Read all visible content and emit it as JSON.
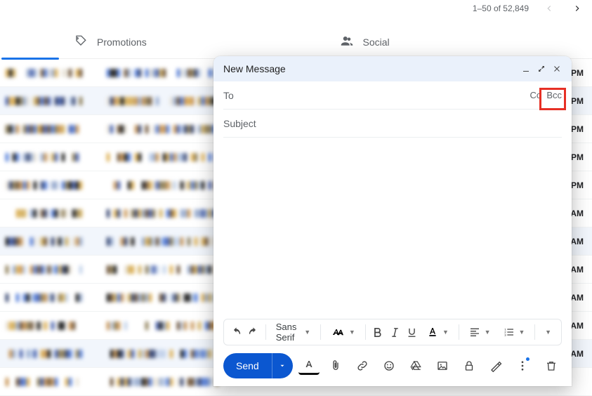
{
  "pager": {
    "range": "1–50 of 52,849"
  },
  "tabs": {
    "promotions": "Promotions",
    "social": "Social"
  },
  "rows": [
    {
      "time": "PM",
      "alt": false
    },
    {
      "time": "PM",
      "alt": true
    },
    {
      "time": "PM",
      "alt": false
    },
    {
      "time": "PM",
      "alt": false
    },
    {
      "time": "PM",
      "alt": false
    },
    {
      "time": "AM",
      "alt": false
    },
    {
      "time": "AM",
      "alt": true
    },
    {
      "time": "AM",
      "alt": false
    },
    {
      "time": "AM",
      "alt": false
    },
    {
      "time": "AM",
      "alt": false
    },
    {
      "time": "AM",
      "alt": true
    },
    {
      "time": "",
      "alt": false
    }
  ],
  "compose": {
    "title": "New Message",
    "to_label": "To",
    "cc": "Cc",
    "bcc": "Bcc",
    "subject_placeholder": "Subject",
    "font": "Sans Serif",
    "send": "Send"
  }
}
